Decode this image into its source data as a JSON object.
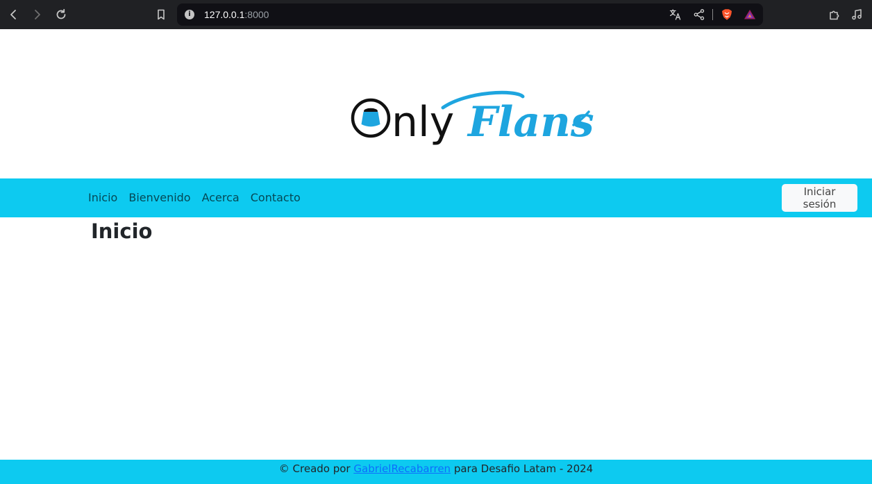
{
  "browser": {
    "url_host": "127.0.0.1",
    "url_port": ":8000"
  },
  "logo": {
    "word_plain": "nly",
    "word_script": "Flans",
    "colors": {
      "dark": "#111111",
      "accent": "#1ea5df"
    }
  },
  "navbar": {
    "links": [
      {
        "label": "Inicio"
      },
      {
        "label": "Bienvenido"
      },
      {
        "label": "Acerca"
      },
      {
        "label": "Contacto"
      }
    ],
    "login_label": "Iniciar sesión",
    "color": "#0dcaf0"
  },
  "main": {
    "title": "Inicio"
  },
  "footer": {
    "prefix": "© Creado por ",
    "author_link": "GabrielRecabarren",
    "suffix": " para Desafio Latam - 2024"
  }
}
